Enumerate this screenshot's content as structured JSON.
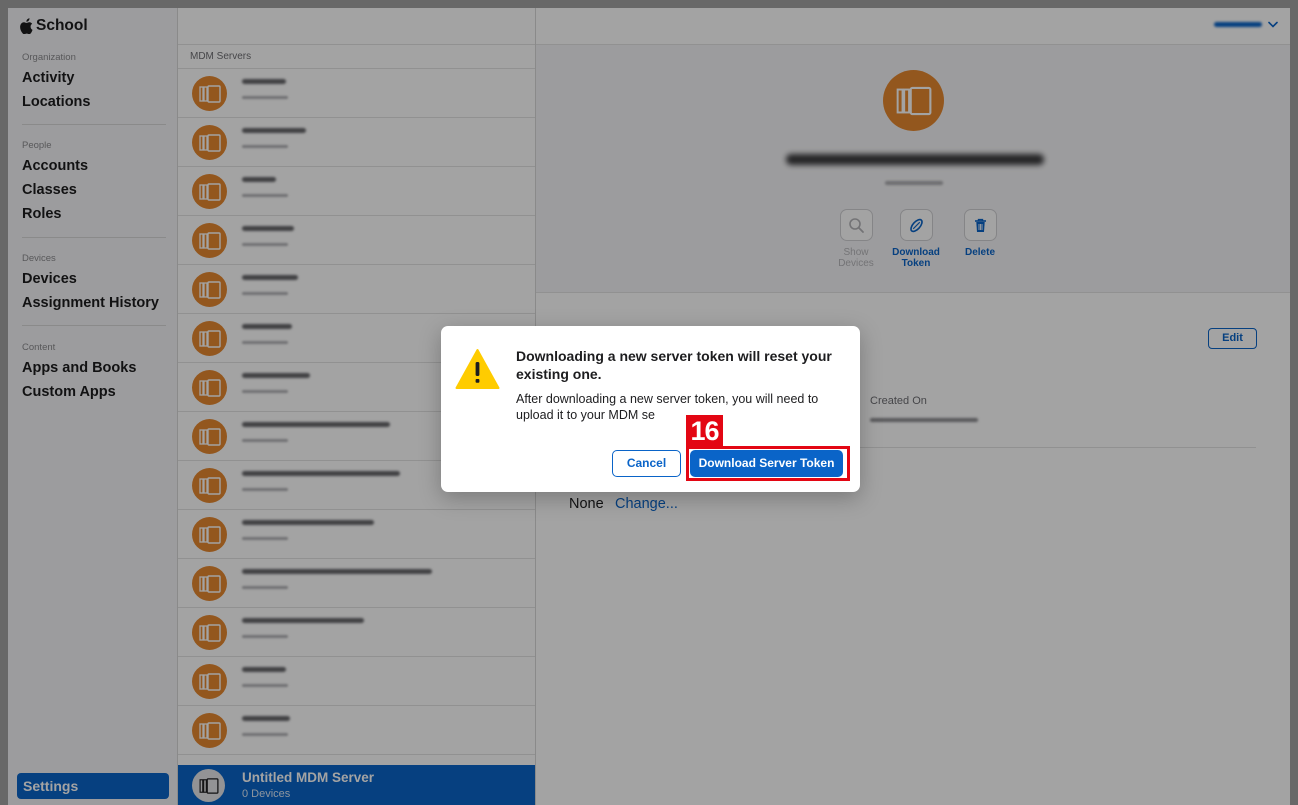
{
  "brand": {
    "label": "School",
    "icon": "apple-logo-icon"
  },
  "sidebar": {
    "sections": [
      {
        "heading": "Organization",
        "items": [
          "Activity",
          "Locations"
        ]
      },
      {
        "heading": "People",
        "items": [
          "Accounts",
          "Classes",
          "Roles"
        ]
      },
      {
        "heading": "Devices",
        "items": [
          "Devices",
          "Assignment History"
        ]
      },
      {
        "heading": "Content",
        "items": [
          "Apps and Books",
          "Custom Apps"
        ]
      }
    ],
    "settings_label": "Settings"
  },
  "server_list": {
    "header": "MDM Servers",
    "selected": {
      "name": "Untitled MDM Server",
      "subtitle": "0 Devices"
    }
  },
  "detail": {
    "actions": [
      {
        "label": "Show Devices",
        "icon": "magnifier-icon",
        "enabled": false
      },
      {
        "label": "Download Token",
        "icon": "token-icon",
        "enabled": true
      },
      {
        "label": "Delete",
        "icon": "trash-icon",
        "enabled": true
      }
    ],
    "edit_label": "Edit",
    "created_on_label": "Created On",
    "assignment_value": "None",
    "change_label": "Change..."
  },
  "dialog": {
    "title": "Downloading a new server token will reset your existing one.",
    "body": "After downloading a new server token, you will need to upload it to your MDM se",
    "cancel_label": "Cancel",
    "confirm_label": "Download Server Token",
    "icon": "warning-icon"
  },
  "annotation": {
    "step": "16"
  },
  "colors": {
    "accent": "#0a64c8",
    "server_orange": "#e7882f",
    "warning_yellow": "#ffcc00",
    "annotation_red": "#e30613"
  }
}
